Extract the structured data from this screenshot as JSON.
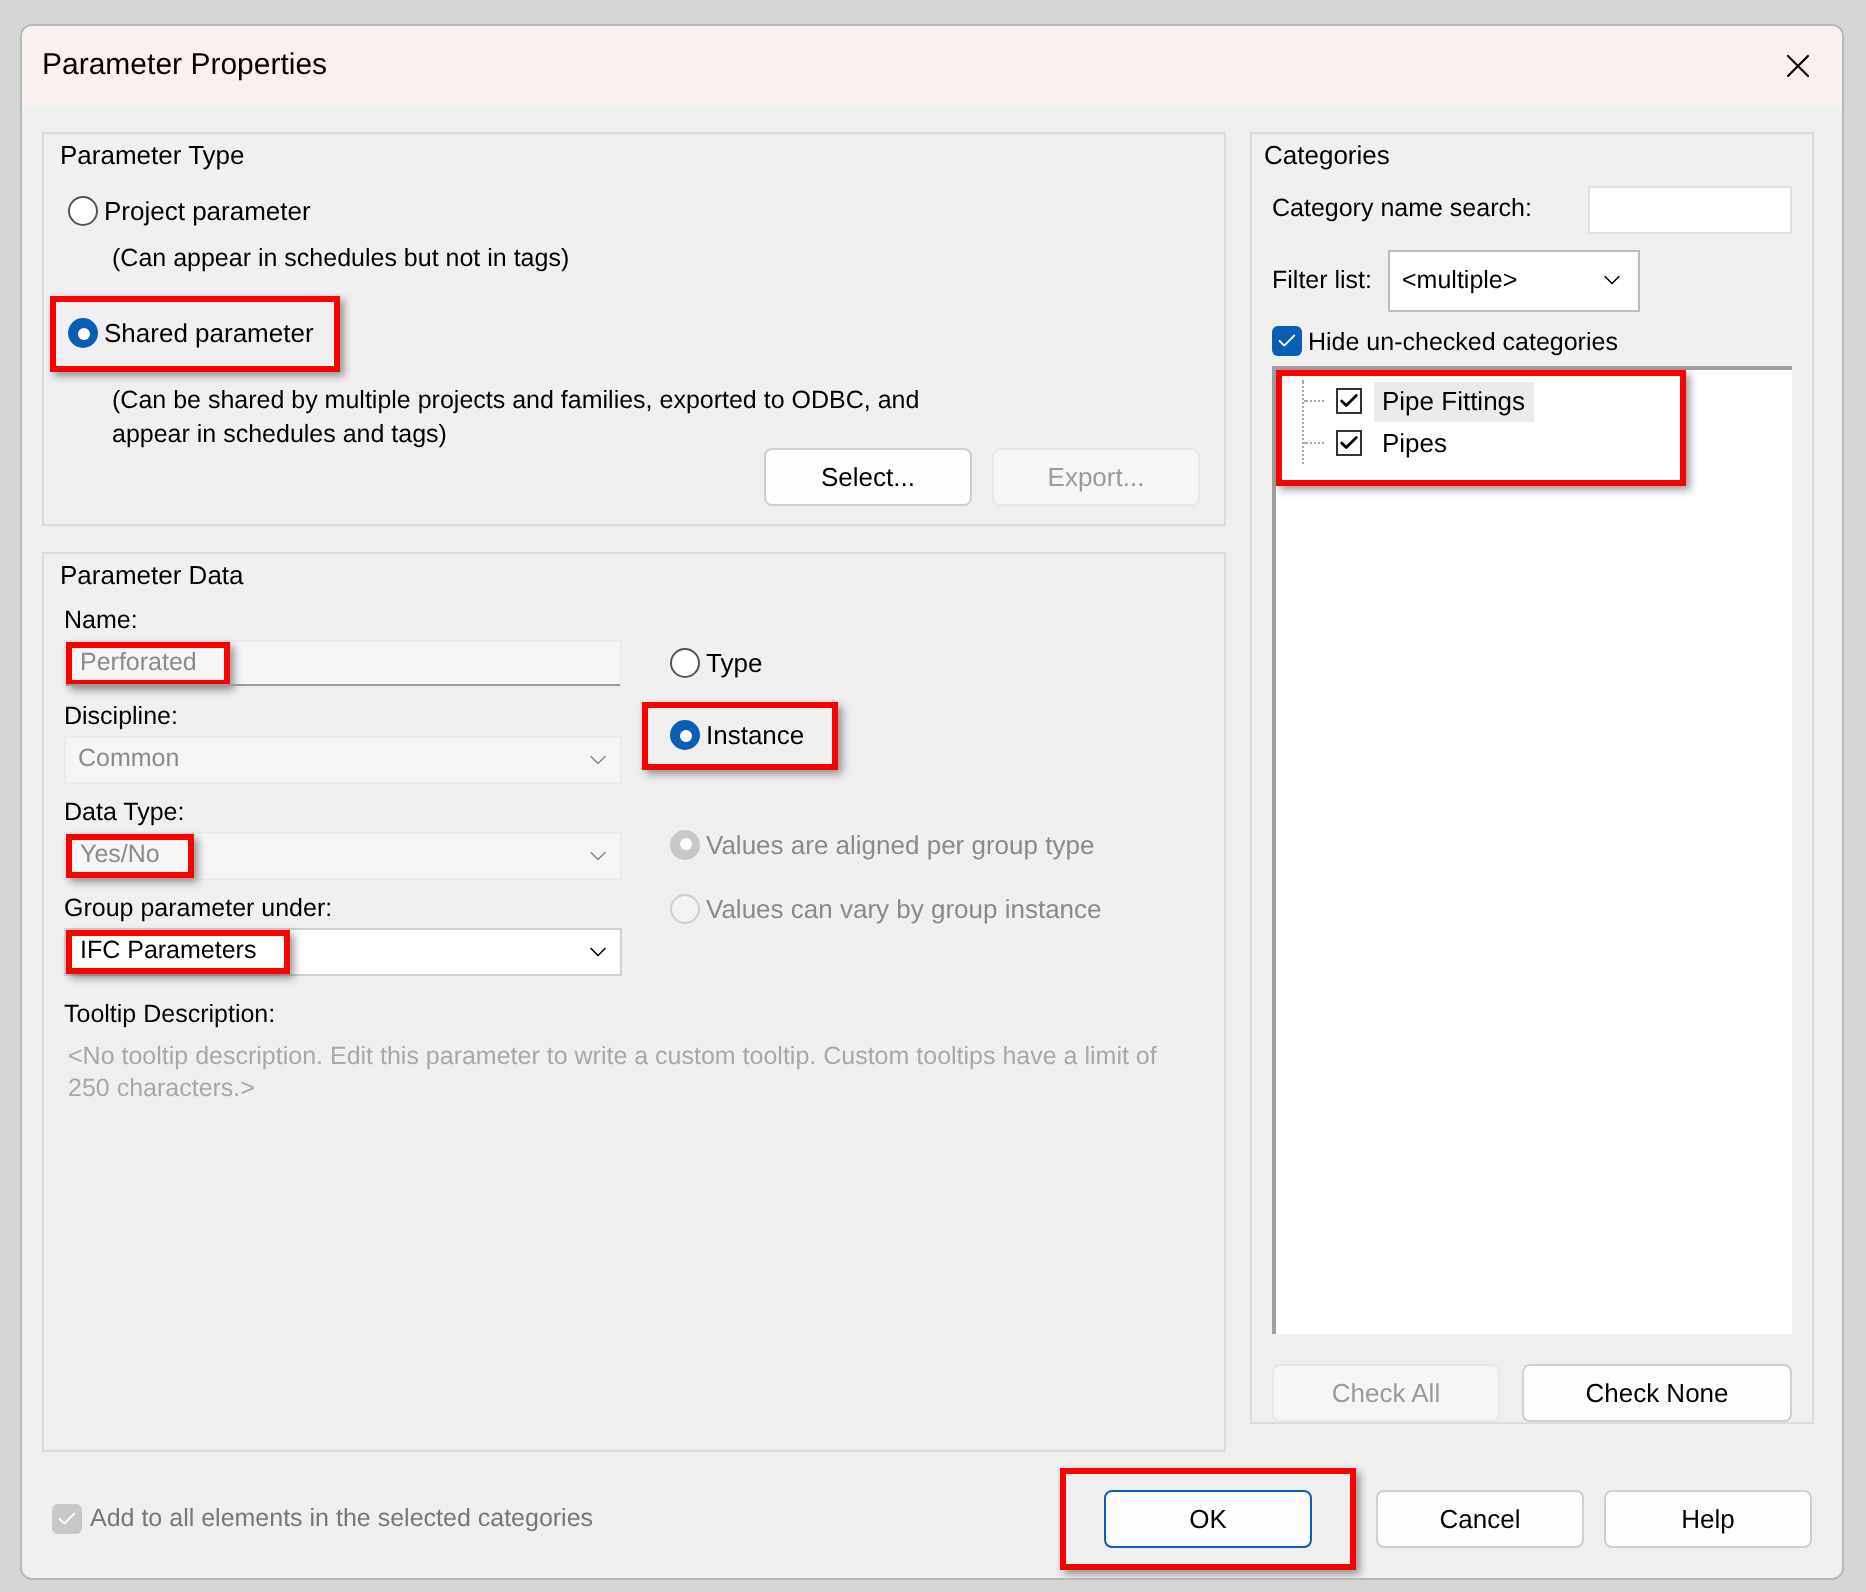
{
  "window": {
    "title": "Parameter Properties"
  },
  "parameter_type": {
    "title": "Parameter Type",
    "options": [
      {
        "label": "Project parameter",
        "note": "(Can appear in schedules but not in tags)",
        "selected": false,
        "highlighted": false
      },
      {
        "label": "Shared parameter",
        "note": "(Can be shared by multiple projects and families, exported to ODBC, and appear in schedules and tags)",
        "selected": true,
        "highlighted": true
      }
    ],
    "buttons": [
      {
        "label": "Select...",
        "disabled": false
      },
      {
        "label": "Export...",
        "disabled": true
      }
    ]
  },
  "parameter_data": {
    "title": "Parameter Data",
    "fields": [
      {
        "label": "Name:",
        "kind": "text",
        "value": "Perforated",
        "disabled": true,
        "highlighted": true
      },
      {
        "label": "Discipline:",
        "kind": "dropdown",
        "value": "Common",
        "disabled": true,
        "highlighted": false
      },
      {
        "label": "Data Type:",
        "kind": "dropdown",
        "value": "Yes/No",
        "disabled": true,
        "highlighted": true
      },
      {
        "label": "Group parameter under:",
        "kind": "dropdown",
        "value": "IFC Parameters",
        "disabled": false,
        "highlighted": true
      }
    ],
    "type_options": [
      {
        "label": "Type",
        "selected": false,
        "disabled": false,
        "highlighted": false
      },
      {
        "label": "Instance",
        "selected": true,
        "disabled": false,
        "highlighted": true
      }
    ],
    "group_options": [
      {
        "label": "Values are aligned per group type",
        "selected": true,
        "disabled": true,
        "highlighted": false
      },
      {
        "label": "Values can vary by group instance",
        "selected": false,
        "disabled": true,
        "highlighted": false
      }
    ],
    "tooltip_label": "Tooltip Description:",
    "tooltip_text": "<No tooltip description. Edit this parameter to write a custom tooltip. Custom tooltips have a limit of 250 characters.>"
  },
  "categories": {
    "title": "Categories",
    "search_label": "Category name search:",
    "filter_label": "Filter list:",
    "filter_value": "<multiple>",
    "hide_unchecked": {
      "label": "Hide un-checked categories",
      "checked": true
    },
    "list_highlighted": true,
    "items": [
      {
        "label": "Pipe Fittings",
        "checked": true,
        "selected": true
      },
      {
        "label": "Pipes",
        "checked": true,
        "selected": false
      }
    ],
    "buttons": [
      {
        "label": "Check All",
        "disabled": true
      },
      {
        "label": "Check None",
        "disabled": false
      }
    ]
  },
  "add_to_all": {
    "label": "Add to all elements in the selected categories",
    "checked": true,
    "disabled": true
  },
  "buttons": [
    {
      "label": "OK",
      "default": true,
      "highlighted": true
    },
    {
      "label": "Cancel",
      "default": false,
      "highlighted": false
    },
    {
      "label": "Help",
      "default": false,
      "highlighted": false
    }
  ]
}
